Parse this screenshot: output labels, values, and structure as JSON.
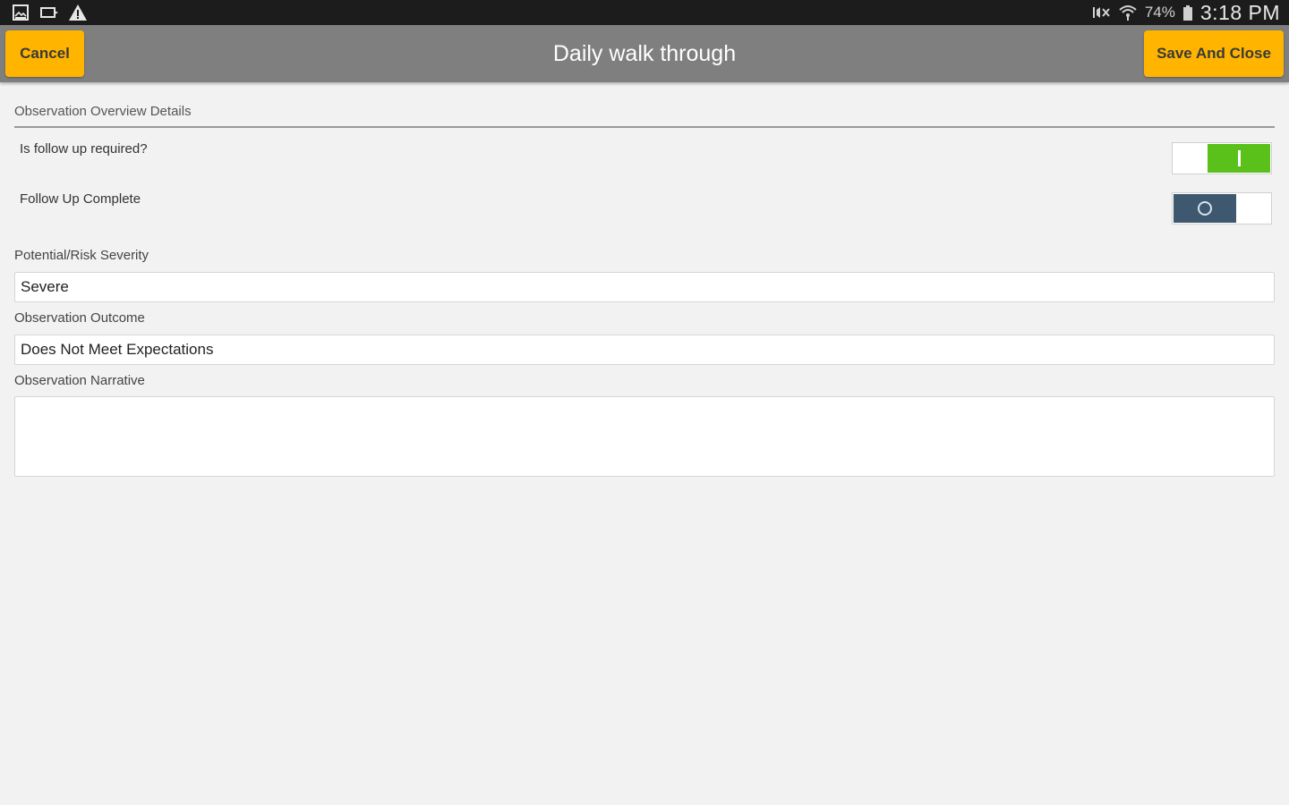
{
  "status_bar": {
    "battery_percent": "74%",
    "time": "3:18 PM",
    "left_icons": [
      "image-notification-icon",
      "cast-icon",
      "warning-icon"
    ],
    "right_icons": [
      "mute-icon",
      "wifi-icon",
      "battery-icon"
    ]
  },
  "header": {
    "title": "Daily walk through",
    "cancel_label": "Cancel",
    "save_label": "Save And Close",
    "accent_color": "#ffb500",
    "bar_color": "#7f7f7f"
  },
  "section": {
    "title": "Observation Overview Details"
  },
  "toggles": [
    {
      "label": "Is follow up required?",
      "state": "on",
      "color": "#5ac01a"
    },
    {
      "label": "Follow Up Complete",
      "state": "off",
      "color": "#3e5870"
    }
  ],
  "fields": {
    "severity": {
      "label": "Potential/Risk Severity",
      "value": "Severe"
    },
    "outcome": {
      "label": "Observation Outcome",
      "value": "Does Not Meet Expectations"
    },
    "narrative": {
      "label": "Observation Narrative",
      "value": ""
    }
  }
}
